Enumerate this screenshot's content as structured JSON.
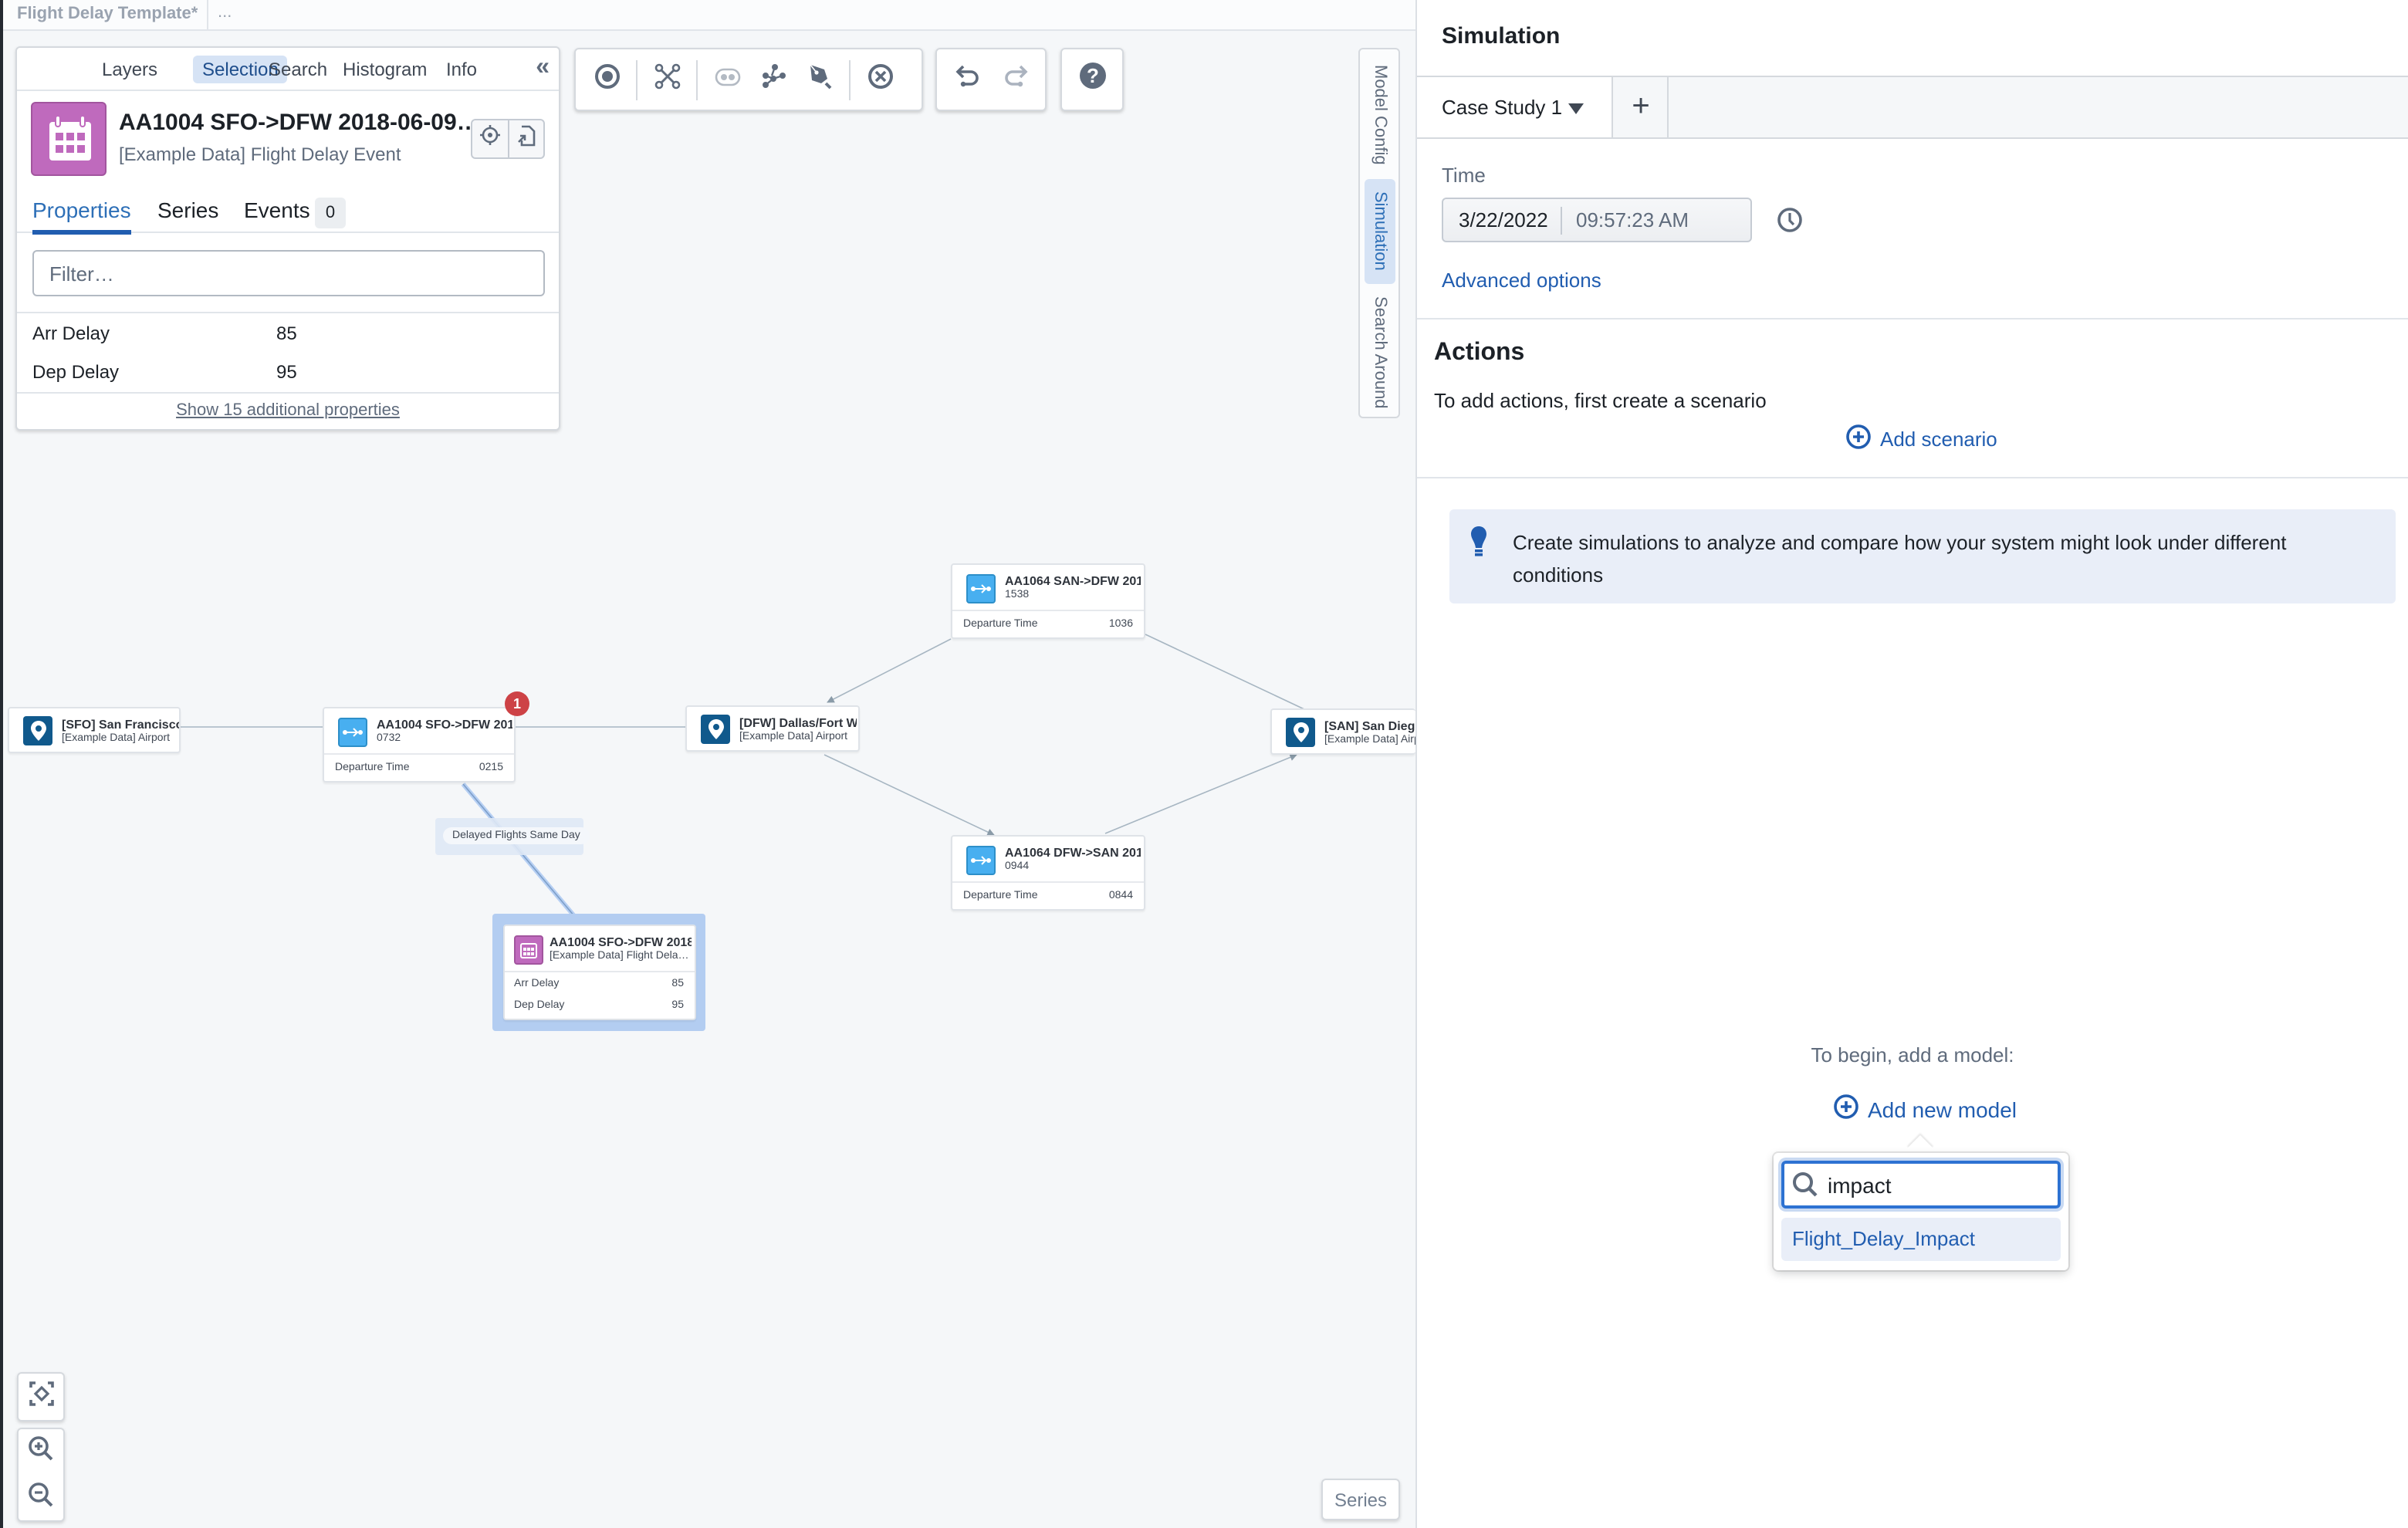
{
  "topbar": {
    "title": "Flight Delay Template*",
    "more": "..."
  },
  "selection_panel": {
    "tabs": [
      {
        "label": "Layers",
        "active": false
      },
      {
        "label": "Selection",
        "active": true
      },
      {
        "label": "Search",
        "active": false
      },
      {
        "label": "Histogram",
        "active": false
      },
      {
        "label": "Info",
        "active": false
      }
    ],
    "collapse_icon": "double-chevron-left-icon",
    "object": {
      "icon": "calendar-icon",
      "title": "AA1004 SFO->DFW 2018-06-09…",
      "type": "[Example Data] Flight Delay Event"
    },
    "subtabs": [
      {
        "label": "Properties",
        "active": true
      },
      {
        "label": "Series",
        "active": false
      },
      {
        "label": "Events",
        "active": false,
        "count": "0"
      }
    ],
    "filter_placeholder": "Filter…",
    "properties": [
      {
        "name": "Arr Delay",
        "value": "85"
      },
      {
        "name": "Dep Delay",
        "value": "95"
      }
    ],
    "show_more": "Show 15 additional properties"
  },
  "toolbar": {
    "groups": [
      [
        "select-icon",
        "expand-icon",
        "link-icon",
        "graph-icon",
        "pen-icon",
        "remove-icon"
      ],
      [
        "undo-icon",
        "redo-icon"
      ],
      [
        "help-icon"
      ]
    ]
  },
  "vertical_tabs": [
    {
      "label": "Model Config",
      "active": false
    },
    {
      "label": "Simulation",
      "active": true
    },
    {
      "label": "Search Around",
      "active": false
    }
  ],
  "graph": {
    "nodes": [
      {
        "id": "sfo",
        "kind": "airport",
        "title": "[SFO] San Francisco …",
        "subtitle": "[Example Data] Airport"
      },
      {
        "id": "aa1004",
        "kind": "flight",
        "title": "AA1004 SFO->DFW 2018…",
        "subtitle": "0732",
        "props": [
          {
            "name": "Departure Time",
            "value": "0215"
          }
        ],
        "badge": "1"
      },
      {
        "id": "dfw",
        "kind": "airport",
        "title": "[DFW] Dallas/Fort W…",
        "subtitle": "[Example Data] Airport"
      },
      {
        "id": "aa1064_san_dfw",
        "kind": "flight",
        "title": "AA1064 SAN->DFW 2018…",
        "subtitle": "1538",
        "props": [
          {
            "name": "Departure Time",
            "value": "1036"
          }
        ]
      },
      {
        "id": "aa1064_dfw_san",
        "kind": "flight",
        "title": "AA1064 DFW->SAN 2018…",
        "subtitle": "0944",
        "props": [
          {
            "name": "Departure Time",
            "value": "0844"
          }
        ]
      },
      {
        "id": "san",
        "kind": "airport",
        "title": "[SAN] San Diego In",
        "subtitle": "[Example Data] Airpo"
      },
      {
        "id": "delay_event",
        "kind": "event",
        "title": "AA1004 SFO->DFW 2018…",
        "subtitle": "[Example Data] Flight Dela…",
        "props": [
          {
            "name": "Arr Delay",
            "value": "85"
          },
          {
            "name": "Dep Delay",
            "value": "95"
          }
        ],
        "selected": true
      }
    ],
    "edges": [
      {
        "from": "sfo",
        "to": "aa1004"
      },
      {
        "from": "aa1004",
        "to": "dfw"
      },
      {
        "from": "aa1064_san_dfw",
        "to": "dfw",
        "arrow": true
      },
      {
        "from": "aa1064_san_dfw",
        "to": "san"
      },
      {
        "from": "dfw",
        "to": "aa1064_dfw_san",
        "arrow": true
      },
      {
        "from": "aa1064_dfw_san",
        "to": "san",
        "arrow": true
      },
      {
        "from": "aa1004",
        "to": "delay_event",
        "label": "Delayed Flights Same Day",
        "highlighted": true
      }
    ]
  },
  "zoom_controls": [
    "fit-icon",
    "zoom-in-icon",
    "zoom-out-icon"
  ],
  "series_button": "Series",
  "simulation": {
    "title": "Simulation",
    "case_tab": "Case Study 1",
    "add_case_icon": "+",
    "time_label": "Time",
    "date": "3/22/2022",
    "time": "09:57:23 AM",
    "advanced_options": "Advanced options",
    "actions_title": "Actions",
    "actions_text": "To add actions, first create a scenario",
    "add_scenario": "Add scenario",
    "callout": "Create simulations to analyze and compare how your system might look under different conditions",
    "begin_text": "To begin, add a model:",
    "add_model": "Add new model",
    "model_search": {
      "value": "impact",
      "results": [
        "Flight_Delay_Impact"
      ]
    }
  },
  "colors": {
    "accent": "#215db0",
    "active_tab_bg": "#d6e3f5",
    "airport_icon": "#10598c",
    "flight_icon": "#48aff0",
    "event_icon": "#bf6abd",
    "alert_badge": "#cd4246",
    "callout_bg": "#e9eef8"
  }
}
